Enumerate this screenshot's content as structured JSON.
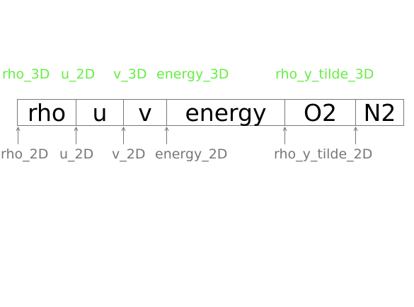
{
  "cells": [
    {
      "label": "rho"
    },
    {
      "label": "u"
    },
    {
      "label": "v"
    },
    {
      "label": "energy"
    },
    {
      "label": "O2"
    },
    {
      "label": "N2"
    }
  ],
  "top_labels": [
    "rho_3D",
    "u_2D",
    "v_3D",
    "energy_3D",
    "rho_y_tilde_3D"
  ],
  "bottom_labels": [
    "rho_2D",
    "u_2D",
    "v_2D",
    "energy_2D",
    "rho_y_tilde_2D"
  ],
  "colors": {
    "top_label": "#66ee44",
    "bottom_label": "#777777",
    "border": "#777777",
    "cell_text": "#000000"
  }
}
